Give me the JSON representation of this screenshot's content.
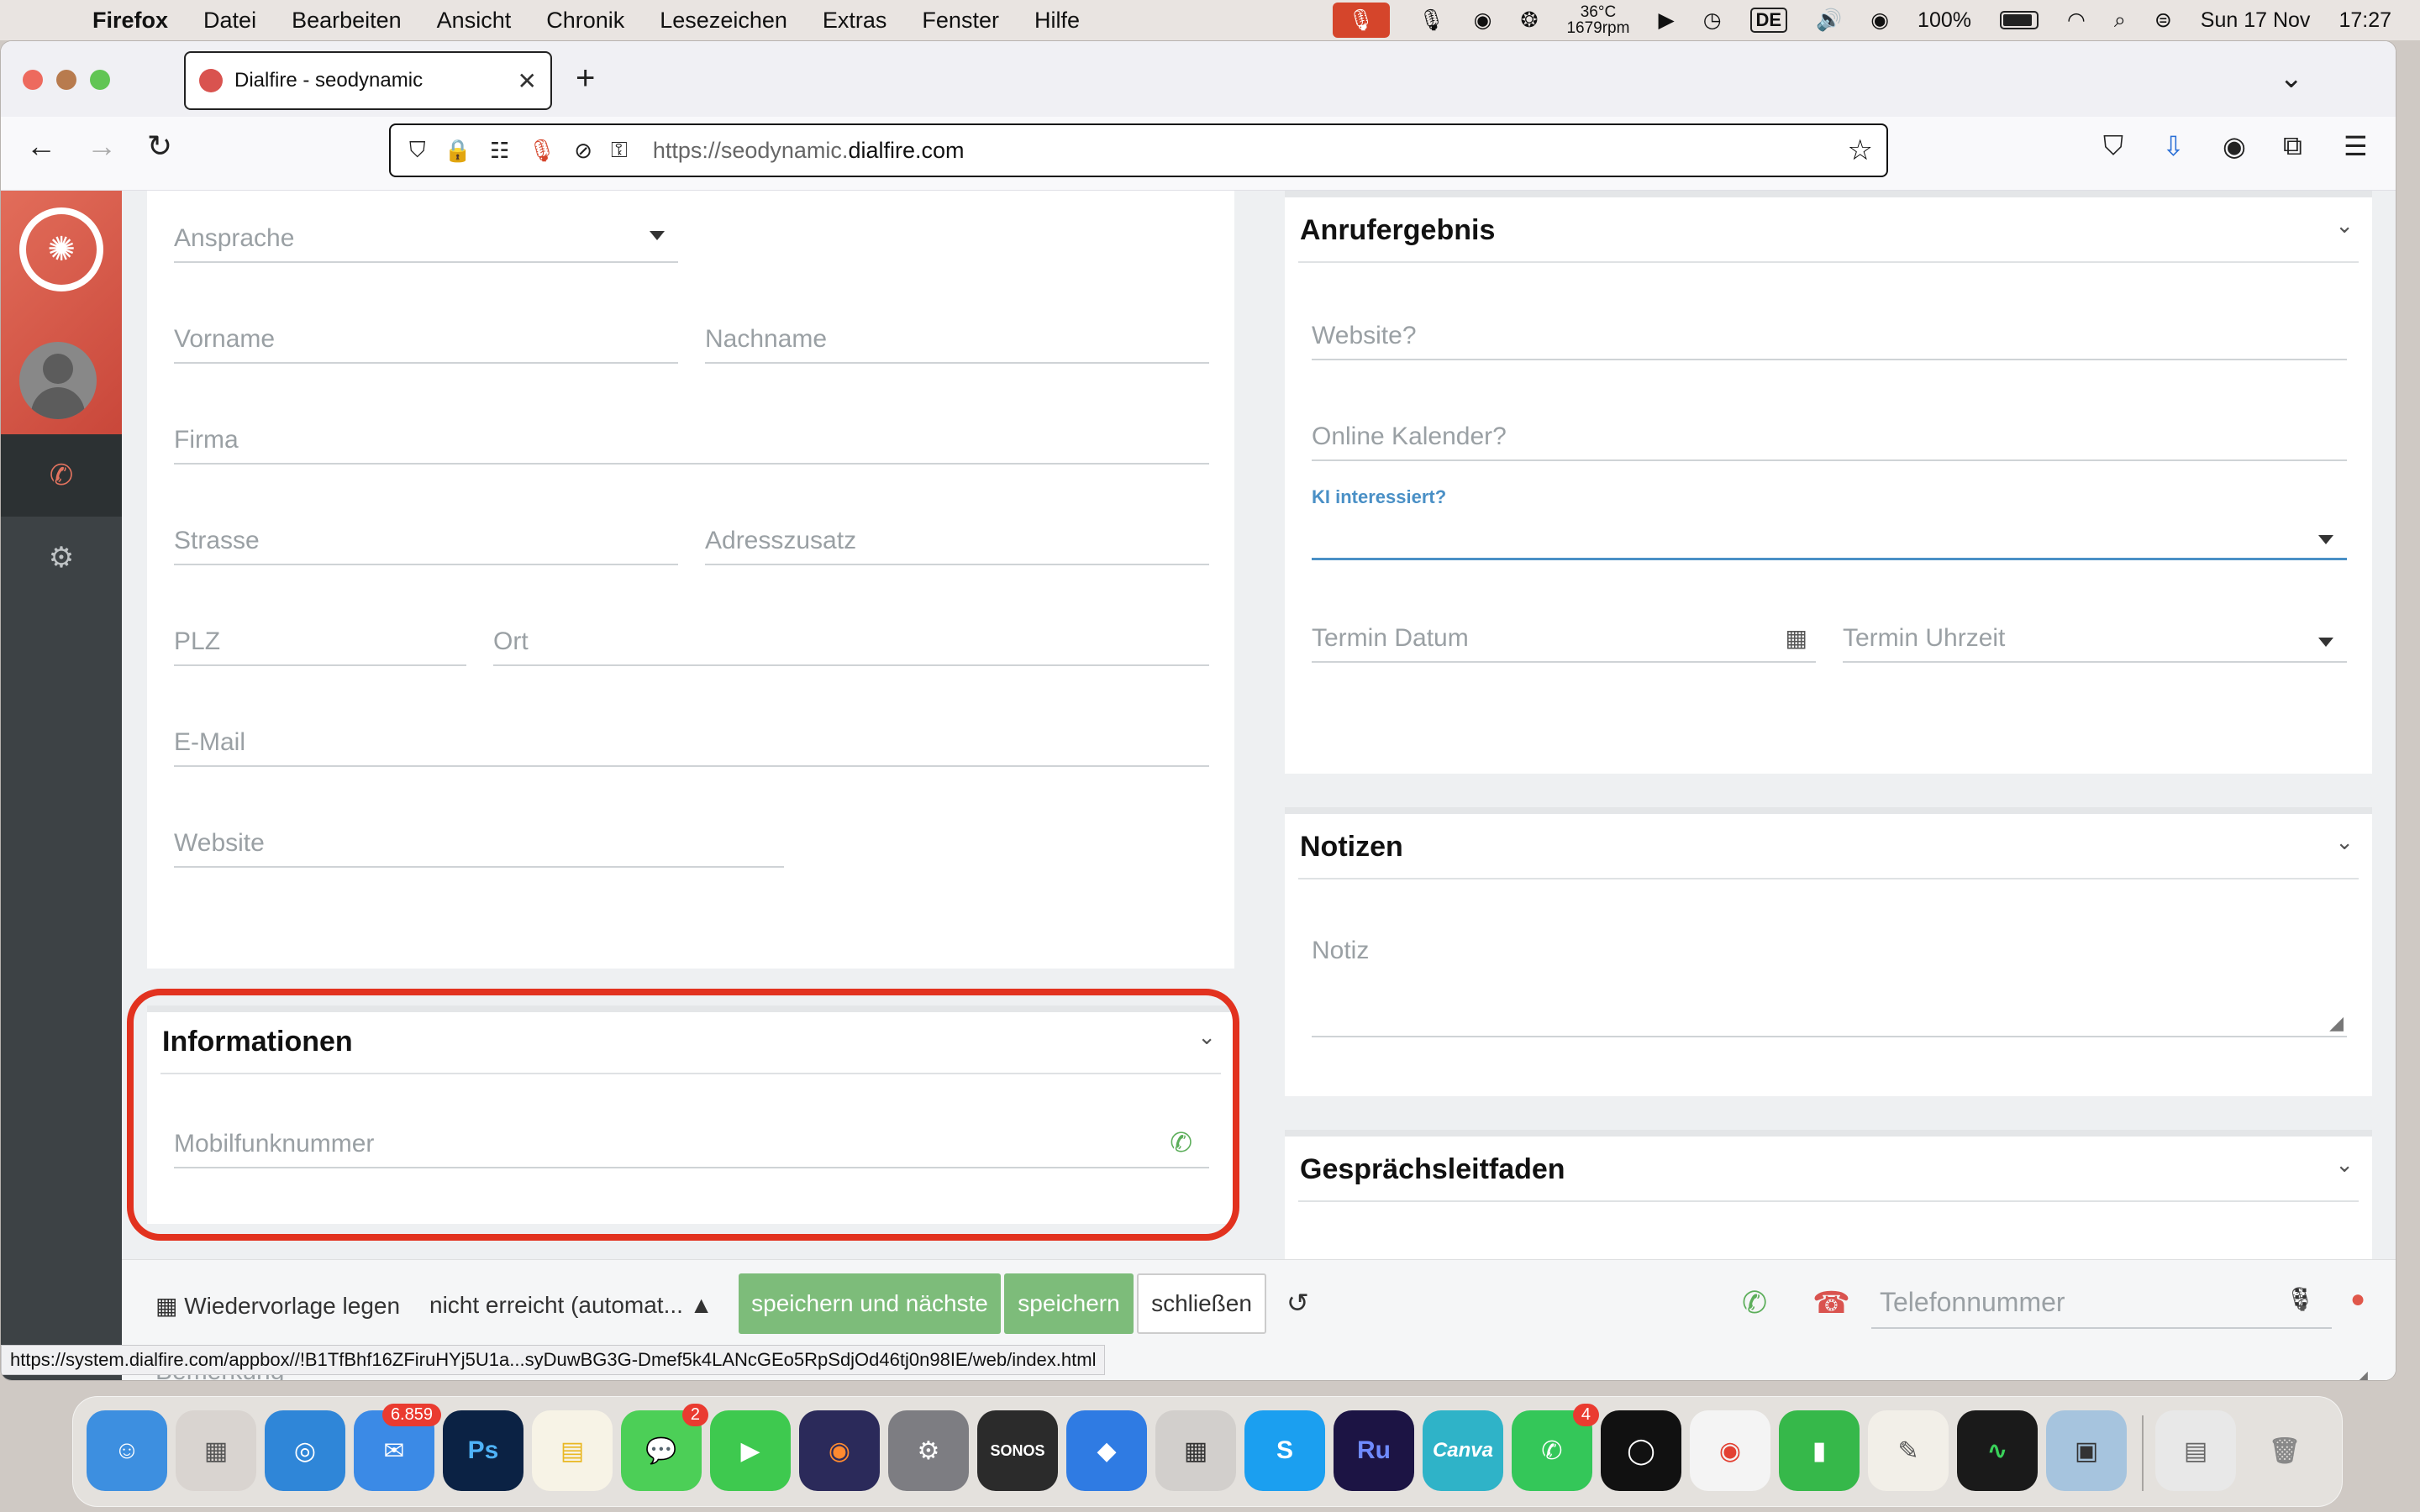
{
  "menubar": {
    "app_name": "Firefox",
    "menus": [
      "Datei",
      "Bearbeiten",
      "Ansicht",
      "Chronik",
      "Lesezeichen",
      "Extras",
      "Fenster",
      "Hilfe"
    ],
    "temperature": "36°C",
    "fan_speed": "1679rpm",
    "keyboard_lang": "DE",
    "battery": "100%",
    "date": "Sun 17 Nov",
    "time": "17:27"
  },
  "browser": {
    "tab_title": "Dialfire - seodynamic",
    "url_prefix": "https://seodynamic.",
    "url_domain": "dialfire.com",
    "status_link": "https://system.dialfire.com/appbox//!B1TfBhf16ZFiruHYj5U1a...syDuwBG3G-Dmef5k4LANcGEo5RpSdjOd46tj0n98IE/web/index.html"
  },
  "contact_form": {
    "ansprache": "Ansprache",
    "vorname": "Vorname",
    "nachname": "Nachname",
    "firma": "Firma",
    "strasse": "Strasse",
    "adresszusatz": "Adresszusatz",
    "plz": "PLZ",
    "ort": "Ort",
    "email": "E-Mail",
    "website": "Website"
  },
  "informationen": {
    "title": "Informationen",
    "mobile": "Mobilfunknummer"
  },
  "anrufergebnis": {
    "title": "Anrufergebnis",
    "website_q": "Website?",
    "kalender_q": "Online Kalender?",
    "ki_label": "KI interessiert?",
    "termin_datum": "Termin Datum",
    "termin_uhrzeit": "Termin Uhrzeit"
  },
  "notizen": {
    "title": "Notizen",
    "notiz": "Notiz"
  },
  "leitfaden": {
    "title": "Gesprächsleitfaden"
  },
  "actionbar": {
    "wiedervorlage": "Wiedervorlage legen",
    "status": "nicht erreicht (automat...",
    "save_next": "speichern und nächste",
    "save": "speichern",
    "close": "schließen",
    "phone_placeholder": "Telefonnummer",
    "bemerkung": "Bemerkung"
  },
  "dock": {
    "mail_badge": "6.859",
    "messages_badge": "2",
    "whatsapp_badge": "4",
    "sonos_label": "SONOS",
    "ps_label": "Ps",
    "ru_label": "Ru",
    "canva_label": "Canva",
    "skype_label": "S"
  },
  "colors": {
    "accent_red": "#e2321f",
    "brand_red": "#d9534f",
    "action_green": "#7dbc7a",
    "link_blue": "#4a90c6"
  }
}
